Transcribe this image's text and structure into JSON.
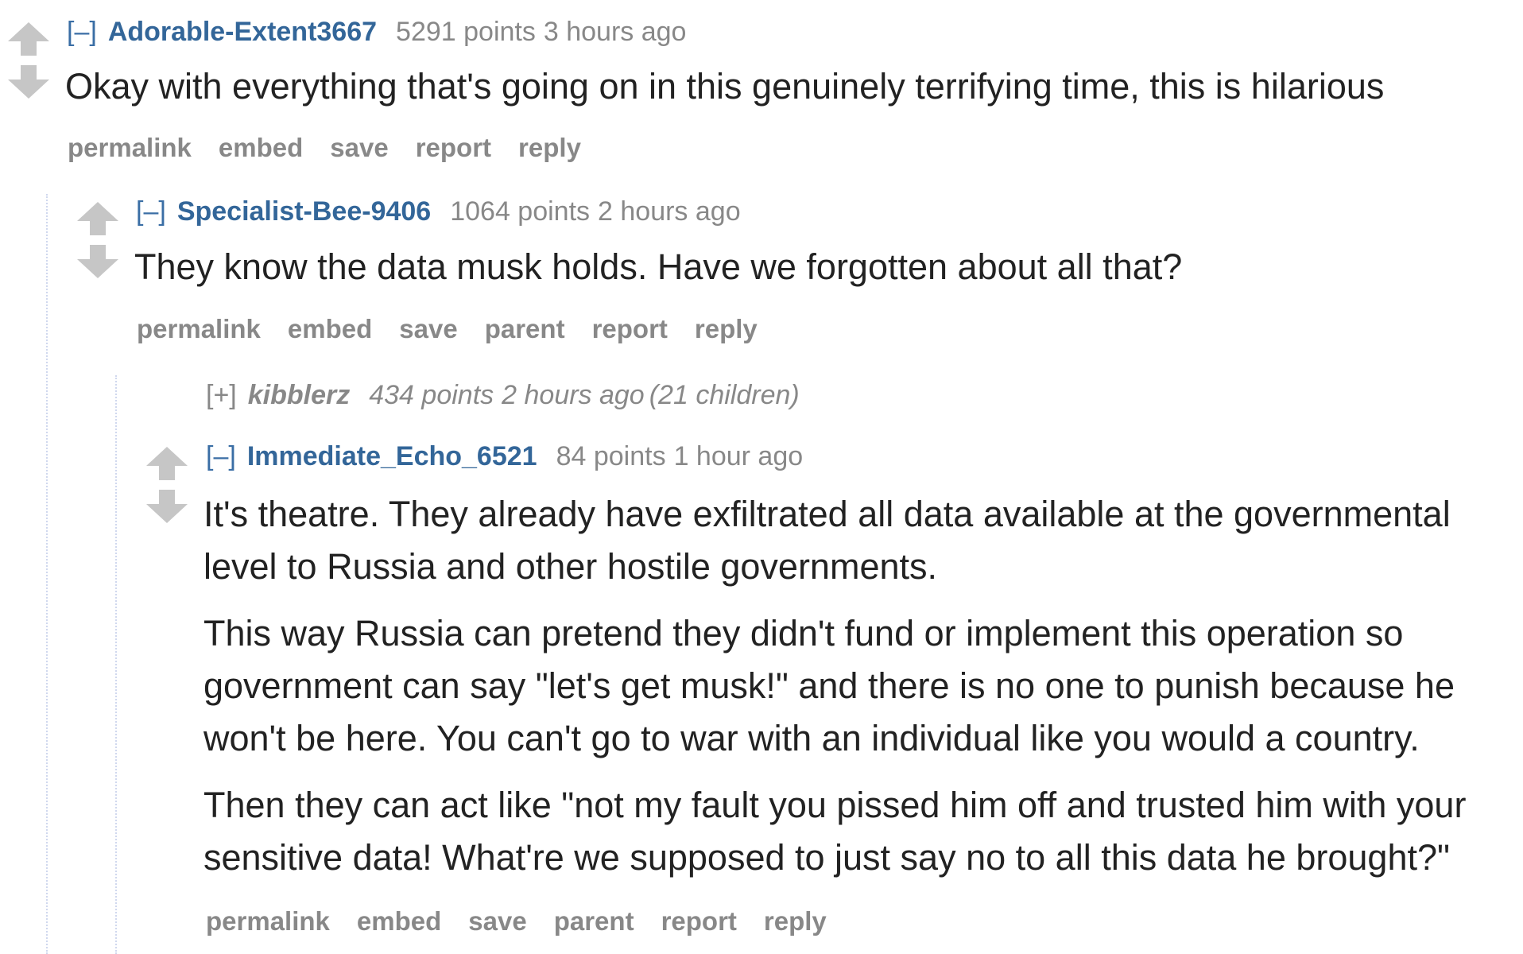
{
  "comments": [
    {
      "expand": "[–]",
      "author": "Adorable-Extent3667",
      "score": "5291 points",
      "time": "3 hours ago",
      "body": [
        "Okay with everything that's going on in this genuinely terrifying time, this is hilarious"
      ],
      "buttons": [
        "permalink",
        "embed",
        "save",
        "report",
        "reply"
      ]
    },
    {
      "expand": "[–]",
      "author": "Specialist-Bee-9406",
      "score": "1064 points",
      "time": "2 hours ago",
      "body": [
        "They know the data musk holds. Have we forgotten about all that?"
      ],
      "buttons": [
        "permalink",
        "embed",
        "save",
        "parent",
        "report",
        "reply"
      ]
    },
    {
      "expand": "[+]",
      "author": "kibblerz",
      "score": "434 points",
      "time": "2 hours ago",
      "children": "(21 children)"
    },
    {
      "expand": "[–]",
      "author": "Immediate_Echo_6521",
      "score": "84 points",
      "time": "1 hour ago",
      "body": [
        "It's theatre. They already have exfiltrated all data available at the governmental level to Russia and other hostile governments.",
        "This way Russia can pretend they didn't fund or implement this operation so government can say \"let's get musk!\" and there is no one to punish because he won't be here. You can't go to war with an individual like you would a country.",
        "Then they can act like \"not my fault you pissed him off and trusted him with your sensitive data! What're we supposed to just say no to all this data he brought?\""
      ],
      "buttons": [
        "permalink",
        "embed",
        "save",
        "parent",
        "report",
        "reply"
      ]
    }
  ],
  "icons": {
    "upvote": "upvote-arrow-icon",
    "downvote": "downvote-arrow-icon"
  },
  "colors": {
    "author": "#336699",
    "meta": "#888888",
    "body": "#222222",
    "arrow": "#c6c6c6"
  }
}
